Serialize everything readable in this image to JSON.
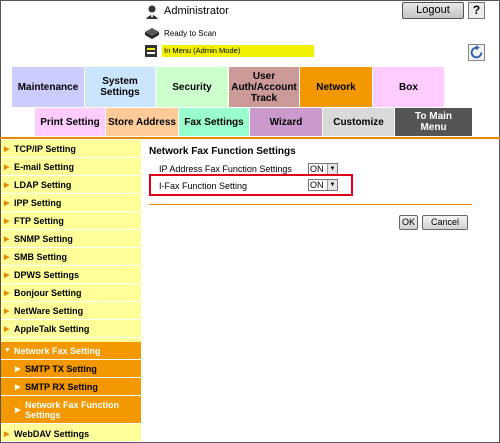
{
  "header": {
    "user_label": "Administrator",
    "logout_label": "Logout",
    "help_label": "?",
    "status_text": "Ready to Scan",
    "mode_text": "In Menu (Admin Mode)"
  },
  "tabs_row1": [
    {
      "label": "Maintenance",
      "color": "#ccccff"
    },
    {
      "label": "System\nSettings",
      "color": "#cce5ff"
    },
    {
      "label": "Security",
      "color": "#ccffcc"
    },
    {
      "label": "User\nAuth/Account\nTrack",
      "color": "#cc9999"
    },
    {
      "label": "Network",
      "color": "#f39800"
    },
    {
      "label": "Box",
      "color": "#ffccff"
    }
  ],
  "tabs_row2": [
    {
      "label": "Print Setting",
      "color": "#ffccff"
    },
    {
      "label": "Store Address",
      "color": "#ffcc99"
    },
    {
      "label": "Fax Settings",
      "color": "#99ffcc"
    },
    {
      "label": "Wizard",
      "color": "#cc99cc"
    },
    {
      "label": "Customize",
      "color": "#d9d9d9"
    },
    {
      "label": "To Main\nMenu",
      "color": "#555555"
    }
  ],
  "sidebar": {
    "items": [
      {
        "label": "TCP/IP Setting"
      },
      {
        "label": "E-mail Setting"
      },
      {
        "label": "LDAP Setting"
      },
      {
        "label": "IPP Setting"
      },
      {
        "label": "FTP Setting"
      },
      {
        "label": "SNMP Setting"
      },
      {
        "label": "SMB Setting"
      },
      {
        "label": "DPWS Settings"
      },
      {
        "label": "Bonjour Setting"
      },
      {
        "label": "NetWare Setting"
      },
      {
        "label": "AppleTalk Setting"
      },
      {
        "label": "Network Fax Setting"
      },
      {
        "label": "SMTP TX Setting"
      },
      {
        "label": "SMTP RX Setting"
      },
      {
        "label": "Network Fax Function Settings"
      },
      {
        "label": "WebDAV Settings"
      }
    ]
  },
  "main": {
    "title": "Network Fax Function Settings",
    "settings": [
      {
        "label": "IP Address Fax Function Settings",
        "value": "ON"
      },
      {
        "label": "I-Fax Function Setting",
        "value": "ON"
      }
    ],
    "ok_label": "OK",
    "cancel_label": "Cancel"
  },
  "colors": {
    "accent": "#f39800",
    "sidebar_bg": "#ffff99",
    "highlight": "#e0001a",
    "mode_bar": "#f0f000"
  }
}
